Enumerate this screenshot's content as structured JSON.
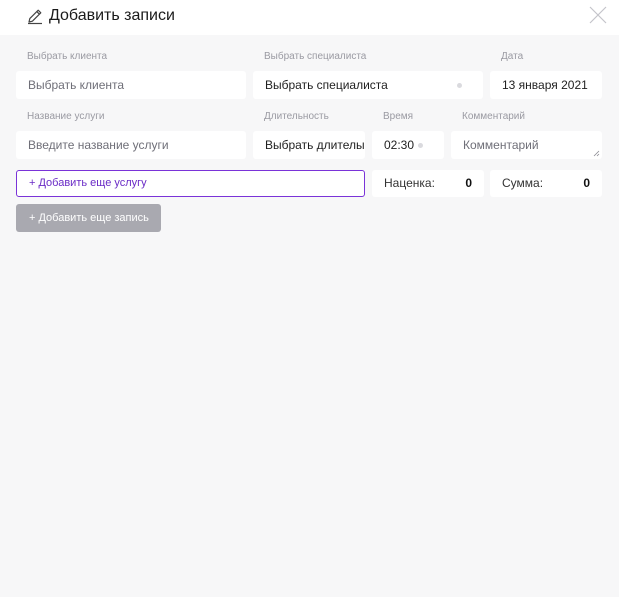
{
  "header": {
    "title": "Добавить записи",
    "edit_icon": "edit-pencil-icon",
    "close_icon": "close-icon"
  },
  "form": {
    "client": {
      "label": "Выбрать клиента",
      "placeholder": "Выбрать клиента"
    },
    "specialist": {
      "label": "Выбрать специалиста",
      "value": "Выбрать специалиста"
    },
    "date": {
      "label": "Дата",
      "value": "13 января 2021"
    },
    "service": {
      "label": "Название услуги",
      "placeholder": "Введите название услуги"
    },
    "duration": {
      "label": "Длительность",
      "value": "Выбрать длителы"
    },
    "time": {
      "label": "Время",
      "value": "02:30"
    },
    "comment": {
      "label": "Комментарий",
      "placeholder": "Комментарий"
    }
  },
  "actions": {
    "add_service": "+ Добавить еще услугу",
    "add_record": "+ Добавить еще запись"
  },
  "totals": {
    "markup_label": "Наценка:",
    "markup_value": "0",
    "sum_label": "Сумма:",
    "sum_value": "0"
  },
  "colors": {
    "background": "#f7f7f8",
    "accent": "#7a33d8",
    "disabled_button": "#a9a9b0"
  }
}
